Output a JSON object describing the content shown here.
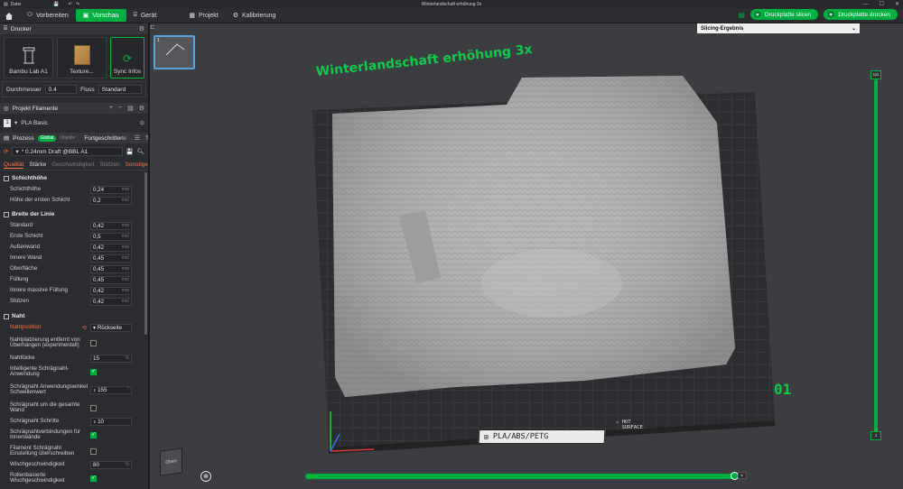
{
  "titlebar": {
    "menu_label": "Datei",
    "window_title": "Winterlandschaft erhöhung 3x",
    "controls": [
      "—",
      "☐",
      "✕"
    ]
  },
  "topbar": {
    "tabs": [
      {
        "label": "Vorbereiten",
        "active": false
      },
      {
        "label": "Vorschau",
        "active": true
      },
      {
        "label": "Gerät",
        "active": false
      },
      {
        "label": "Projekt",
        "active": false
      },
      {
        "label": "Kalibrierung",
        "active": false
      }
    ],
    "slice_button": "Druckplatte slicen",
    "print_button": "Druckplatte drucken"
  },
  "sidebar": {
    "printer_section": "Drucker",
    "printer_name": "Bambu Lab A1",
    "texture_label": "Texture...",
    "sync_label": "Sync Infos",
    "diameter_label": "Durchmesser",
    "diameter_value": "0.4",
    "flow_label": "Fluss",
    "flow_value": "Standard",
    "filament_section": "Projekt Filamente",
    "filament_index": "1",
    "filament_name": "PLA Basic",
    "process_section": "Prozess",
    "process_badge_global": "Global",
    "process_badge_objects": "Objekte",
    "advanced_label": "Fortgeschritten",
    "profile_name": "* 0.24mm Draft @BBL A1",
    "subtabs": [
      {
        "label": "Qualität",
        "state": "active"
      },
      {
        "label": "Stärke",
        "state": "normal"
      },
      {
        "label": "Geschwindigkeit",
        "state": "dim"
      },
      {
        "label": "Stützen",
        "state": "dim"
      },
      {
        "label": "Sonstige",
        "state": "warn"
      }
    ],
    "groups": {
      "layer_height": {
        "title": "Schichthöhe",
        "rows": [
          {
            "label": "Schichthöhe",
            "value": "0,24",
            "unit": "mm"
          },
          {
            "label": "Höhe der ersten Schicht",
            "value": "0,2",
            "unit": "mm"
          }
        ]
      },
      "line_width": {
        "title": "Breite der Linie",
        "rows": [
          {
            "label": "Standard",
            "value": "0,42",
            "unit": "mm"
          },
          {
            "label": "Erste Schicht",
            "value": "0,5",
            "unit": "mm"
          },
          {
            "label": "Außenwand",
            "value": "0,42",
            "unit": "mm"
          },
          {
            "label": "Innere Wand",
            "value": "0,45",
            "unit": "mm"
          },
          {
            "label": "Oberfläche",
            "value": "0,45",
            "unit": "mm"
          },
          {
            "label": "Füllung",
            "value": "0,45",
            "unit": "mm"
          },
          {
            "label": "Innere massive Füllung",
            "value": "0,42",
            "unit": "mm"
          },
          {
            "label": "Stützen",
            "value": "0,42",
            "unit": "mm"
          }
        ]
      },
      "seam": {
        "title": "Naht",
        "seam_position_label": "Nahtposition",
        "seam_position_value": "Rückseite",
        "seam_overhang_label": "Nahtplatzierung entfernt von Überhängen (experimentell)",
        "seam_gap_label": "Nahtlücke",
        "seam_gap_value": "15",
        "seam_gap_unit": "%",
        "smart_scarf_label": "Intelligente Schrägnaht-Anwendung",
        "scarf_angle_label": "Schrägnaht Anwendungswinkel Schwellenwert",
        "scarf_angle_value": "155",
        "scarf_angle_unit": "°",
        "scarf_whole_wall_label": "Schrägnaht um die gesamte Wand",
        "scarf_steps_label": "Schrägnaht Schritte",
        "scarf_steps_value": "10",
        "scarf_inner_label": "Schrägnahtverbindungen für Innenwände",
        "scarf_override_label": "Filament Schrägnaht Einstellung überschreiben",
        "wipe_speed_label": "Wischgeschwindigkeit",
        "wipe_speed_value": "80",
        "wipe_speed_unit": "%",
        "roller_wipe_label": "Rollenbasierte Wischgeschwindigkeit"
      }
    }
  },
  "viewport": {
    "thumb_number": "1",
    "slicing_result_label": "Slicing-Ergebnis",
    "model_title": "Winterlandschaft erhöhung 3x",
    "plate_number": "01",
    "plate_label": "PLA/ABS/PETG",
    "hot_label_line1": "HOT",
    "hot_label_line2": "SURFACE",
    "layer_top": "111",
    "layer_bottom": "1",
    "cube_label": "Oben"
  },
  "colors": {
    "accent_green": "#00ae42",
    "title_green": "#10c84a",
    "warn_orange": "#ff7043"
  }
}
